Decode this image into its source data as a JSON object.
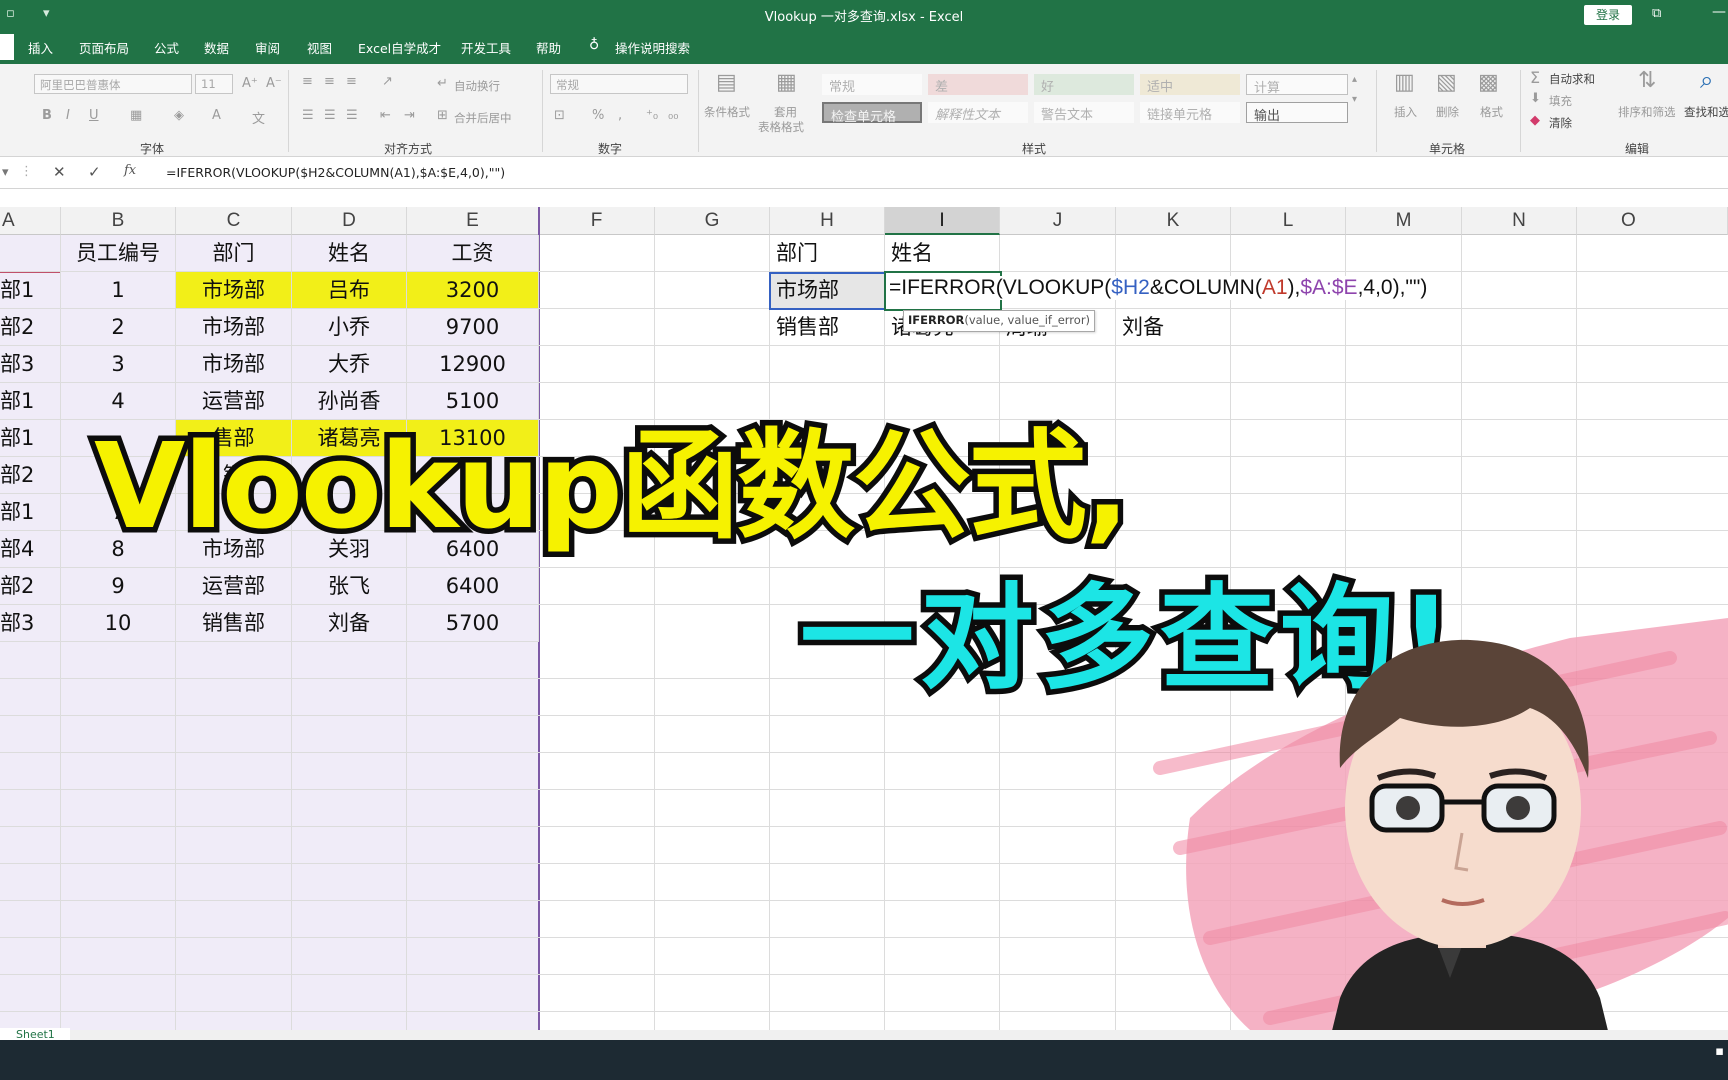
{
  "window": {
    "title": "Vlookup 一对多查询.xlsx - Excel",
    "login_label": "登录"
  },
  "tabs": [
    "插入",
    "页面布局",
    "公式",
    "数据",
    "审阅",
    "视图",
    "Excel自学成才",
    "开发工具",
    "帮助"
  ],
  "tell_me": "操作说明搜索",
  "ribbon": {
    "font_name": "阿里巴巴普惠体",
    "font_size": "11",
    "wrap_text": "自动换行",
    "merge_center": "合并后居中",
    "number_format": "常规",
    "conditional_format": "条件格式",
    "format_as_table_1": "套用",
    "format_as_table_2": "表格格式",
    "cell_styles": {
      "row1": [
        "常规",
        "差",
        "好",
        "适中",
        "计算"
      ],
      "row2": [
        "检查单元格",
        "解释性文本",
        "警告文本",
        "链接单元格",
        "输出"
      ]
    },
    "insert": "插入",
    "delete": "删除",
    "format": "格式",
    "autosum": "自动求和",
    "fill": "填充",
    "clear": "清除",
    "sort_filter": "排序和筛选",
    "find_select": "查找和选",
    "groups": {
      "font": "字体",
      "alignment": "对齐方式",
      "number": "数字",
      "styles": "样式",
      "cells": "单元格",
      "editing": "编辑"
    }
  },
  "formula_bar": {
    "formula": "=IFERROR(VLOOKUP($H2&COLUMN(A1),$A:$E,4,0),\"\")"
  },
  "columns": [
    "A",
    "B",
    "C",
    "D",
    "E",
    "F",
    "G",
    "H",
    "I",
    "J",
    "K",
    "L",
    "M",
    "N",
    "O"
  ],
  "table": {
    "headers": [
      "员工编号",
      "部门",
      "姓名",
      "工资"
    ],
    "rows": [
      {
        "a": "部1",
        "id": "1",
        "dept": "市场部",
        "name": "吕布",
        "salary": "3200"
      },
      {
        "a": "部2",
        "id": "2",
        "dept": "市场部",
        "name": "小乔",
        "salary": "9700"
      },
      {
        "a": "部3",
        "id": "3",
        "dept": "市场部",
        "name": "大乔",
        "salary": "12900"
      },
      {
        "a": "部1",
        "id": "4",
        "dept": "运营部",
        "name": "孙尚香",
        "salary": "5100"
      },
      {
        "a": "部1",
        "id": "",
        "dept": "售部",
        "name": "诸葛亮",
        "salary": "13100"
      },
      {
        "a": "部2",
        "id": "",
        "dept": "销",
        "name": "",
        "salary": "52"
      },
      {
        "a": "部1",
        "id": "7",
        "dept": "",
        "name": "",
        "salary": ""
      },
      {
        "a": "部4",
        "id": "8",
        "dept": "市场部",
        "name": "关羽",
        "salary": "6400"
      },
      {
        "a": "部2",
        "id": "9",
        "dept": "运营部",
        "name": "张飞",
        "salary": "6400"
      },
      {
        "a": "部3",
        "id": "10",
        "dept": "销售部",
        "name": "刘备",
        "salary": "5700"
      }
    ]
  },
  "lookup": {
    "h1": "部门",
    "i1": "姓名",
    "h2": "市场部",
    "h3": "销售部",
    "i3": "诸葛亮",
    "j3": "周瑜",
    "k3": "刘备"
  },
  "cell_edit": {
    "p1": "=IFERROR(VLOOKUP(",
    "ref1": "$H2",
    "p2": "&COLUMN(",
    "ref2": "A1",
    "p3": "),",
    "ref3": "$A:$E",
    "p4": ",4,0),\"\")"
  },
  "tooltip": {
    "fn": "IFERROR",
    "args": "(value, value_if_error)"
  },
  "overlay": {
    "line1": "Vlookup函数公式,",
    "line2": "一对多查询!"
  },
  "sheet_tab": "Sheet1",
  "colors": {
    "excel_green": "#217346",
    "highlight_yellow": "#f2ef18",
    "headline_yellow": "#f6f200",
    "headline_cyan": "#1ce5e5"
  }
}
